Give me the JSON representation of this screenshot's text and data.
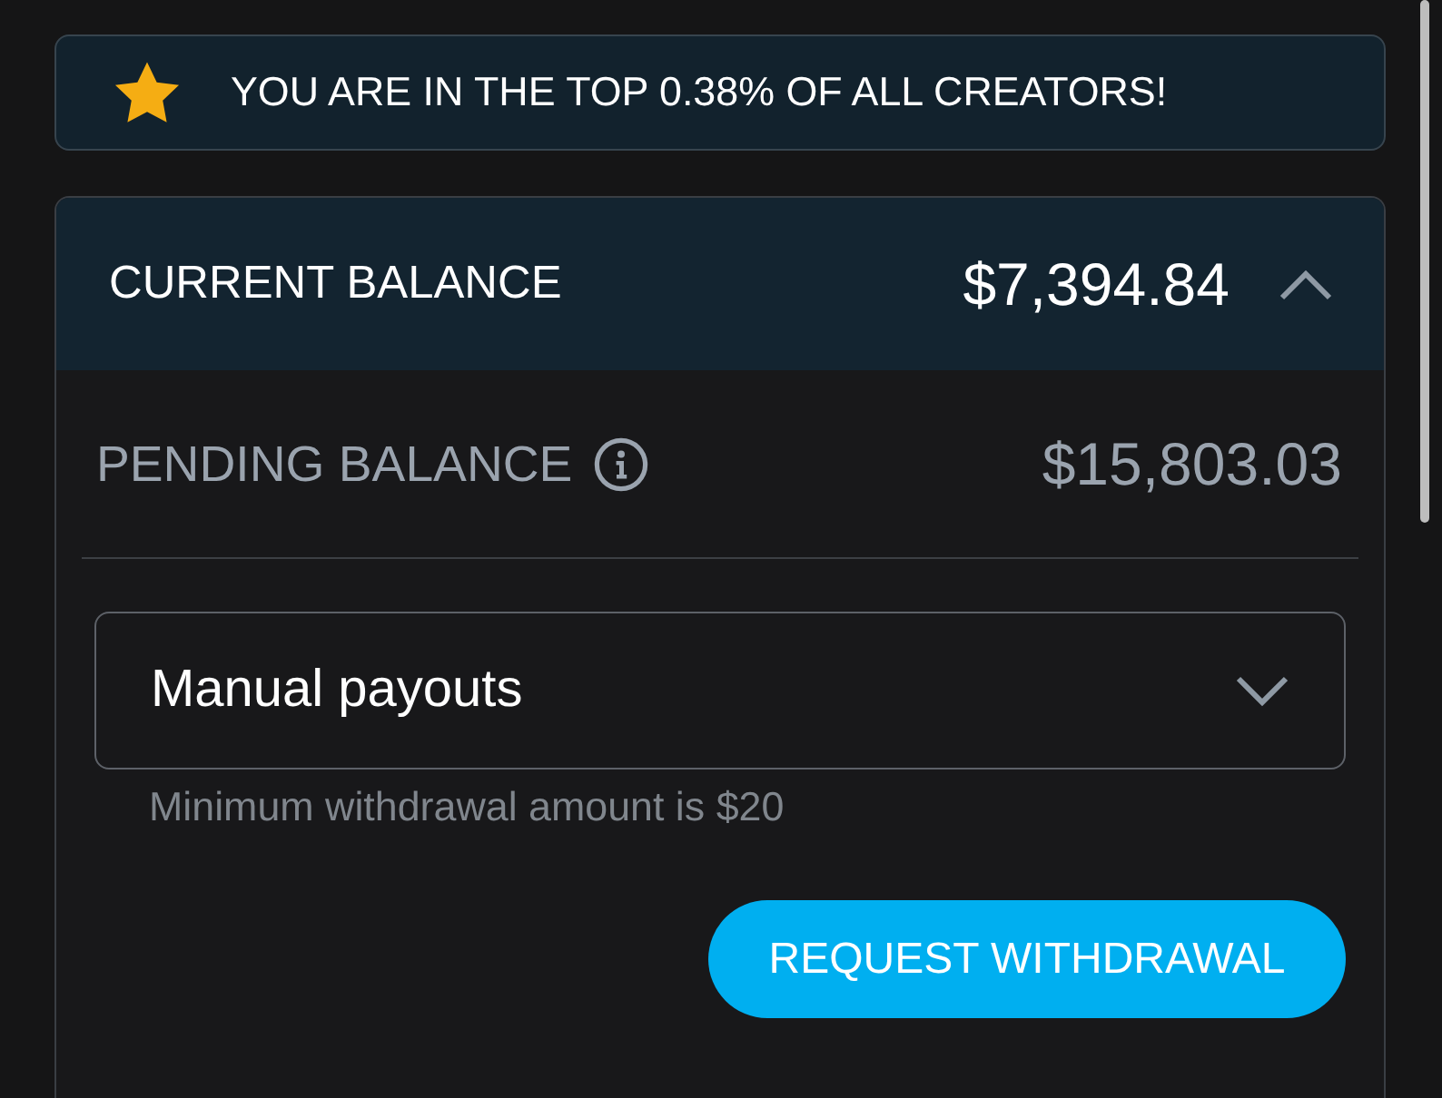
{
  "banner": {
    "text": "YOU ARE IN THE TOP 0.38% OF ALL CREATORS!"
  },
  "balance_card": {
    "title": "CURRENT BALANCE",
    "amount": "$7,394.84",
    "expanded": true,
    "pending": {
      "label": "PENDING BALANCE",
      "amount": "$15,803.03"
    },
    "payout_select": {
      "value": "Manual payouts"
    },
    "hint": "Minimum withdrawal amount is $20",
    "button": "REQUEST WITHDRAWAL"
  }
}
